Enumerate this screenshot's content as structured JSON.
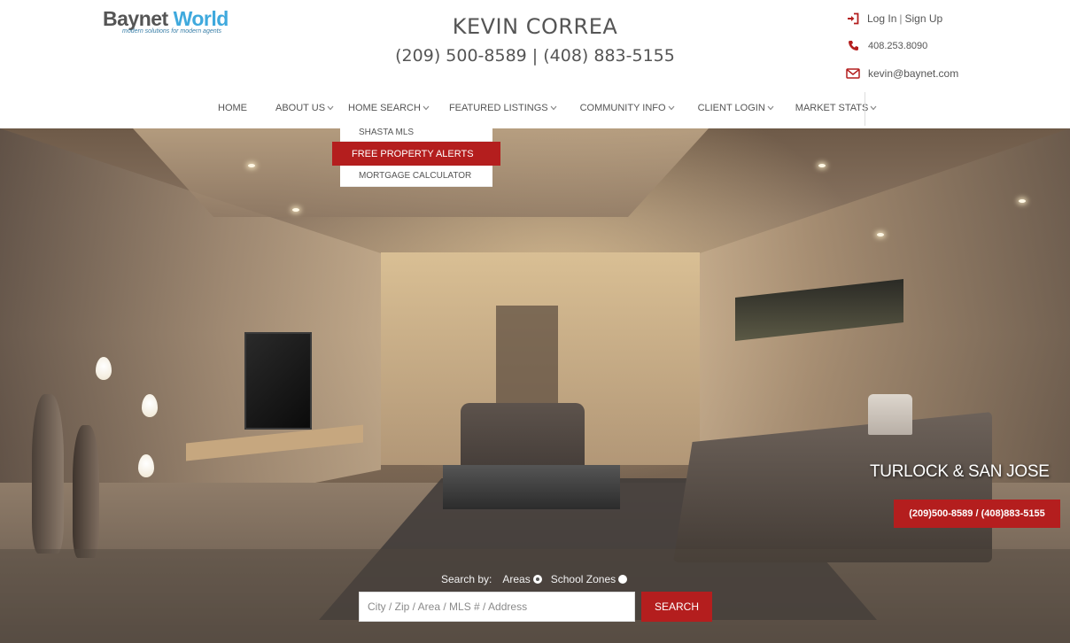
{
  "brand": {
    "logo_part1": "Baynet",
    "logo_part2": "World",
    "tagline": "modern solutions for modern agents",
    "accent_color": "#b41e1e",
    "logo_color": "#3fa9dd"
  },
  "agent": {
    "name": "KEVIN CORREA",
    "phones": "(209) 500-8589 | (408) 883-5155"
  },
  "contact": {
    "login_label": "Log In",
    "separator": "|",
    "signup_label": "Sign Up",
    "phone": "408.253.8090",
    "email": "kevin@baynet.com",
    "icons": [
      "sign-in-icon",
      "phone-icon",
      "envelope-icon"
    ]
  },
  "nav": {
    "items": [
      {
        "label": "HOME",
        "has_dropdown": false
      },
      {
        "label": "ABOUT US",
        "has_dropdown": true
      },
      {
        "label": "HOME SEARCH",
        "has_dropdown": true
      },
      {
        "label": "FEATURED LISTINGS",
        "has_dropdown": true
      },
      {
        "label": "COMMUNITY INFO",
        "has_dropdown": true
      },
      {
        "label": "CLIENT LOGIN",
        "has_dropdown": true
      },
      {
        "label": "MARKET STATS",
        "has_dropdown": true
      }
    ]
  },
  "dropdown": {
    "items": [
      {
        "label": "SHASTA MLS"
      },
      {
        "label": "FREE PROPERTY ALERTS"
      },
      {
        "label": "MORTGAGE CALCULATOR"
      }
    ]
  },
  "hero": {
    "location": "TURLOCK & SAN JOSE",
    "phones": "(209)500-8589 / (408)883-5155"
  },
  "search": {
    "by_label": "Search by:",
    "option_areas": "Areas",
    "option_school": "School Zones",
    "placeholder": "City / Zip / Area / MLS # / Address",
    "button_label": "SEARCH"
  }
}
